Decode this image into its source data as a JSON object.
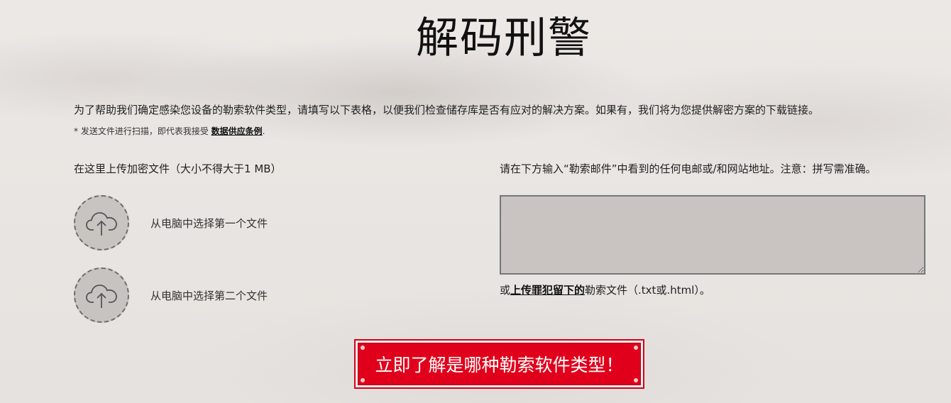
{
  "page": {
    "title": "解码刑警",
    "intro": "为了帮助我们确定感染您设备的勒索软件类型，请填写以下表格，以便我们检查储存库是否有应对的解决方案。如果有，我们将为您提供解密方案的下载链接。",
    "note_prefix": "* 发送文件进行扫描，即代表我接受 ",
    "note_link": "数据供应条例",
    "note_suffix": "."
  },
  "upload": {
    "label": "在这里上传加密文件（大小不得大于1 MB）",
    "file1_label": "从电脑中选择第一个文件",
    "file2_label": "从电脑中选择第二个文件",
    "icon": "cloud-upload-icon"
  },
  "email": {
    "label": "请在下方输入“勒索邮件”中看到的任何电邮或/和网站地址。注意：拼写需准确。",
    "value": "",
    "alt_prefix": "或",
    "alt_link": "上传罪犯留下的",
    "alt_suffix": "勒索文件（.txt或.html）。"
  },
  "submit": {
    "label": "立即了解是哪种勒索软件类型！"
  },
  "colors": {
    "accent": "#e0001b",
    "background": "#ebe7e3"
  }
}
